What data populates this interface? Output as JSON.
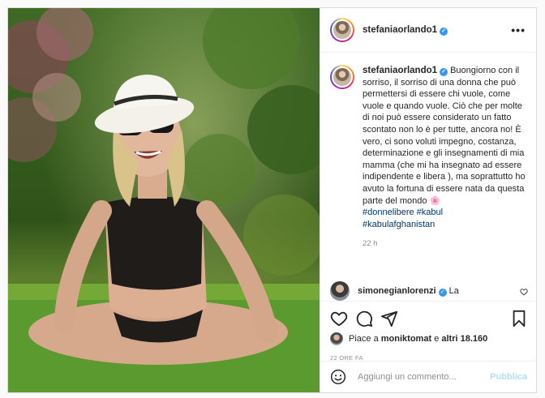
{
  "post": {
    "username": "stefaniaorlando1",
    "more_label": "•••",
    "caption": "Buongiorno con il sorriso, il sorriso di una donna che può permettersi di essere chi vuole, come vuole e quando vuole. Ciò che per molte di noi può essere considerato un fatto scontato non lo è per tutte, ancora no! È vero, ci sono voluti impegno, costanza, determinazione e gli insegnamenti di mia mamma (che mi ha insegnato ad essere indipendente e libera ), ma soprattutto ho avuto la fortuna di essere nata da questa parte del mondo 🌸",
    "hashtags": [
      "#donnelibere #kabul",
      "#kabulafghanistan"
    ],
    "time_ago": "22 h"
  },
  "comment": {
    "username": "simonegianlorenzi",
    "text": "La"
  },
  "likes": {
    "prefix": "Piace a",
    "user": "moniktomat",
    "middle": "e",
    "others": "altri 18.160"
  },
  "date_label": "22 ORE FA",
  "add_comment": {
    "placeholder": "Aggiungi un commento...",
    "post_label": "Pubblica"
  },
  "icons": [
    "heart-icon",
    "comment-icon",
    "share-icon",
    "bookmark-icon",
    "emoji-icon",
    "verified-icon",
    "more-icon"
  ],
  "colors": {
    "hashtag": "#00376b",
    "verified": "#3897f0",
    "post_button": "#b2dffc",
    "muted": "#8e8e8e"
  }
}
